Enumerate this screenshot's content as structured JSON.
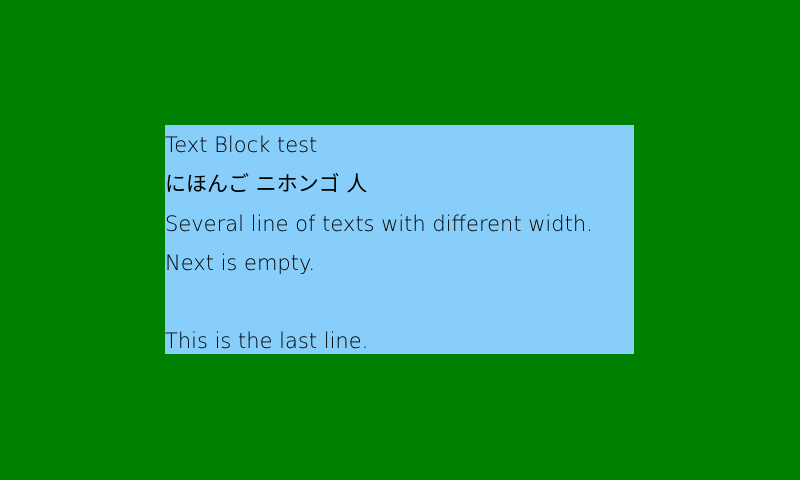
{
  "colors": {
    "background": "#008000",
    "block": "#87cefa",
    "text": "#000000"
  },
  "text_block": {
    "lines": [
      "Text Block test",
      "にほんご ニホンゴ 人",
      "Several line of texts with different width.",
      "Next is empty.",
      "",
      "This is the last line."
    ]
  }
}
